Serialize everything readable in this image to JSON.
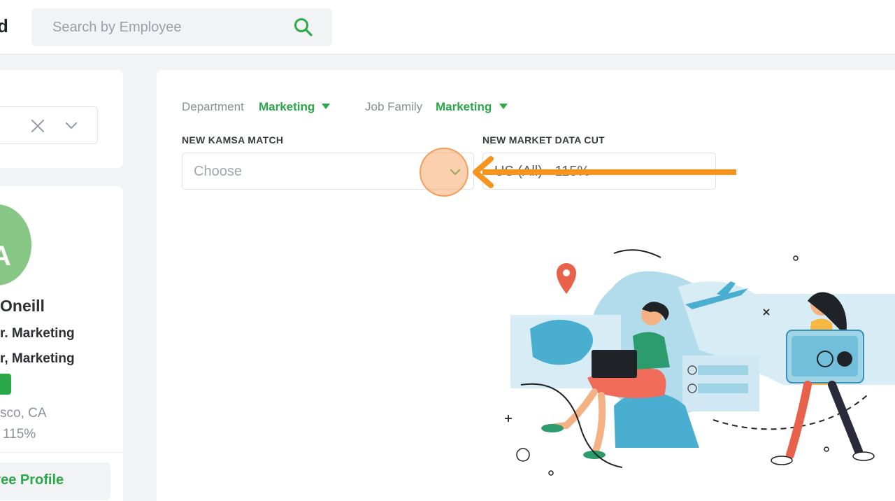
{
  "header": {
    "brand_fragment": "d",
    "search": {
      "placeholder": "Search by Employee",
      "value": ""
    }
  },
  "filter_panel": {
    "selected_value": ""
  },
  "profile": {
    "avatar_initial": "A",
    "name_fragment": "Oneill",
    "title_line_1": "r. Marketing",
    "title_line_2": "r, Marketing",
    "location_fragment": "sco, CA",
    "percent": "115%",
    "button_label": "yee Profile"
  },
  "filters": {
    "department": {
      "label": "Department",
      "value": "Marketing"
    },
    "job_family": {
      "label": "Job Family",
      "value": "Marketing"
    }
  },
  "form": {
    "kamsa_match": {
      "label": "NEW KAMSA MATCH",
      "placeholder": "Choose"
    },
    "market_data_cut": {
      "label": "NEW MARKET DATA CUT",
      "value": "US (All) - 115%"
    }
  },
  "colors": {
    "accent_green": "#2ba84a",
    "annotation_orange": "#f7941d"
  }
}
